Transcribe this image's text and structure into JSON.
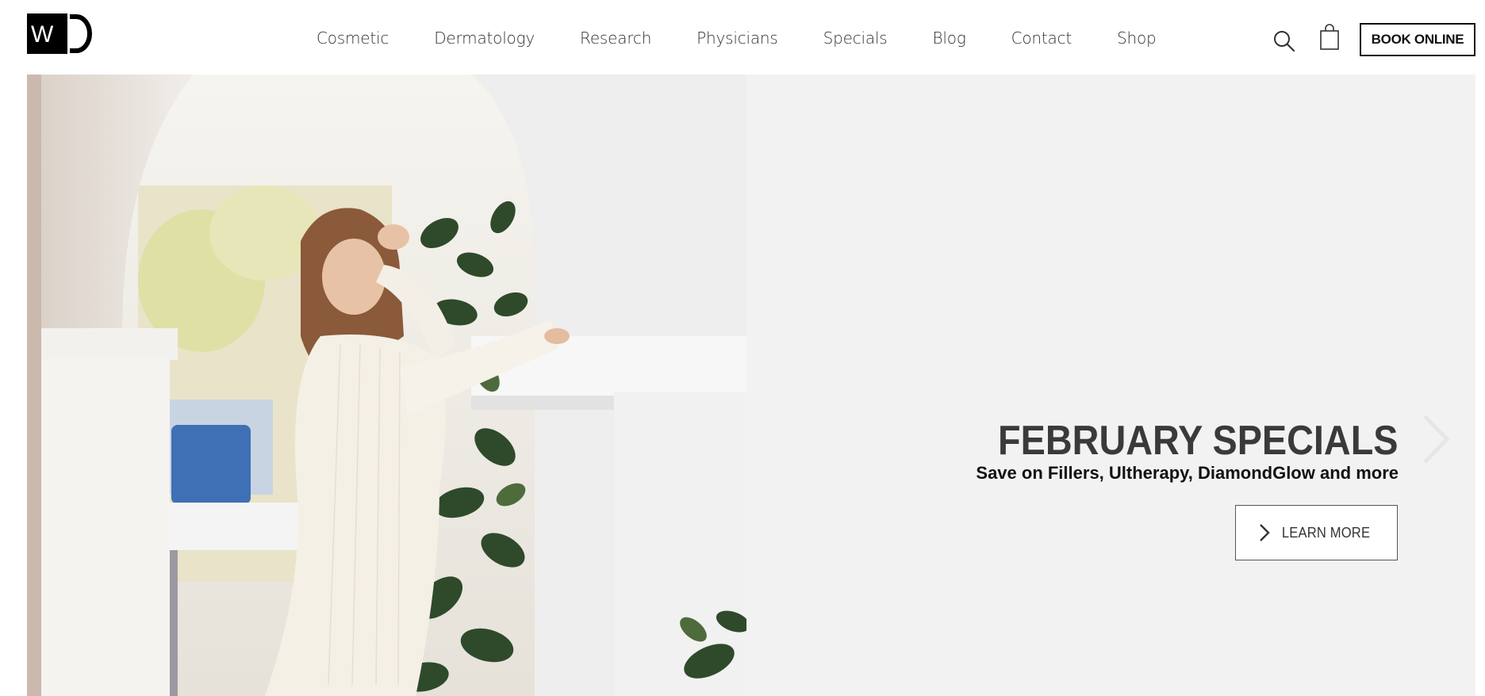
{
  "brand": {
    "logo_text": "W"
  },
  "nav": {
    "items": [
      {
        "label": "Cosmetic"
      },
      {
        "label": "Dermatology"
      },
      {
        "label": "Research"
      },
      {
        "label": "Physicians"
      },
      {
        "label": "Specials"
      },
      {
        "label": "Blog"
      },
      {
        "label": "Contact"
      },
      {
        "label": "Shop"
      }
    ]
  },
  "header_actions": {
    "search_icon": "search-icon",
    "cart_icon": "shopping-bag-icon",
    "book_label": "BOOK ONLINE"
  },
  "hero": {
    "title": "FEBRUARY SPECIALS",
    "subtitle": "Save on Fillers, Ultherapy, DiamondGlow and more",
    "cta_label": "LEARN MORE",
    "cta_icon": "chevron-right-icon",
    "next_icon": "chevron-right-icon",
    "background_color": "#f2f2f3"
  }
}
